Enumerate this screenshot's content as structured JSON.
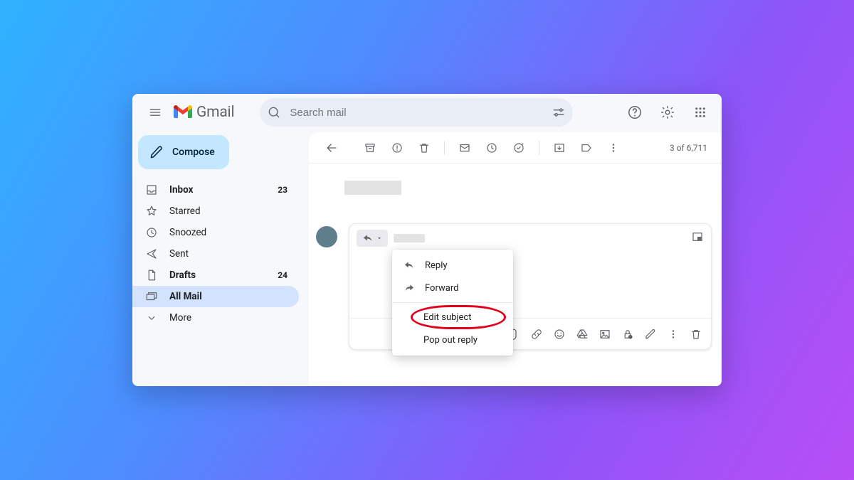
{
  "header": {
    "app_name": "Gmail",
    "search_placeholder": "Search mail"
  },
  "sidebar": {
    "compose_label": "Compose",
    "items": [
      {
        "label": "Inbox",
        "count": "23",
        "bold": true
      },
      {
        "label": "Starred",
        "count": "",
        "bold": false
      },
      {
        "label": "Snoozed",
        "count": "",
        "bold": false
      },
      {
        "label": "Sent",
        "count": "",
        "bold": false
      },
      {
        "label": "Drafts",
        "count": "24",
        "bold": true
      },
      {
        "label": "All Mail",
        "count": "",
        "bold": true,
        "active": true
      },
      {
        "label": "More",
        "count": "",
        "bold": false
      }
    ]
  },
  "toolbar": {
    "position_text": "3 of 6,711"
  },
  "reply_menu": {
    "reply": "Reply",
    "forward": "Forward",
    "edit_subject": "Edit subject",
    "pop_out": "Pop out reply"
  }
}
